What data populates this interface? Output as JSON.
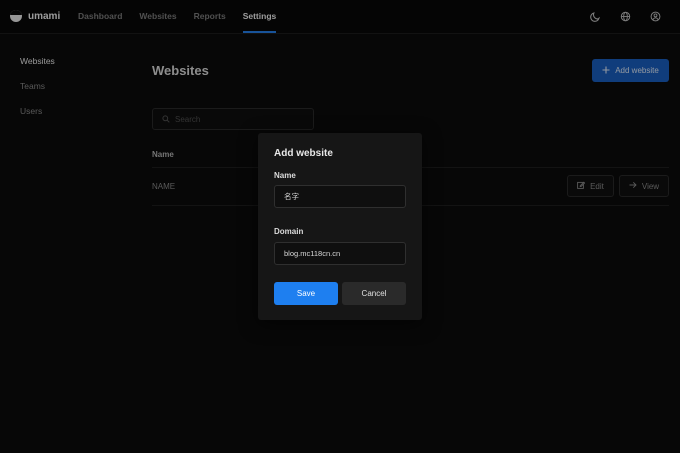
{
  "app": {
    "name": "umami"
  },
  "nav": {
    "items": [
      {
        "label": "Dashboard",
        "active": false
      },
      {
        "label": "Websites",
        "active": false
      },
      {
        "label": "Reports",
        "active": false
      },
      {
        "label": "Settings",
        "active": true
      }
    ]
  },
  "top_icons": [
    "moon-icon",
    "globe-icon",
    "user-circle-icon"
  ],
  "sidebar": {
    "items": [
      {
        "label": "Websites",
        "active": true
      },
      {
        "label": "Teams",
        "active": false
      },
      {
        "label": "Users",
        "active": false
      }
    ]
  },
  "main": {
    "title": "Websites",
    "add_button_label": "Add website",
    "search_placeholder": "Search",
    "search_value": "",
    "table": {
      "columns": [
        "Name"
      ],
      "rows": [
        {
          "name": "NAME",
          "edit_label": "Edit",
          "view_label": "View"
        }
      ]
    }
  },
  "modal": {
    "title": "Add website",
    "name_label": "Name",
    "name_value": "名字",
    "domain_label": "Domain",
    "domain_value": "blog.mc118cn.cn",
    "save_label": "Save",
    "cancel_label": "Cancel"
  },
  "colors": {
    "accent": "#1e7ff0",
    "nav_underline": "#2680eb",
    "background": "#0b0b0b",
    "modal_bg": "#161616"
  }
}
